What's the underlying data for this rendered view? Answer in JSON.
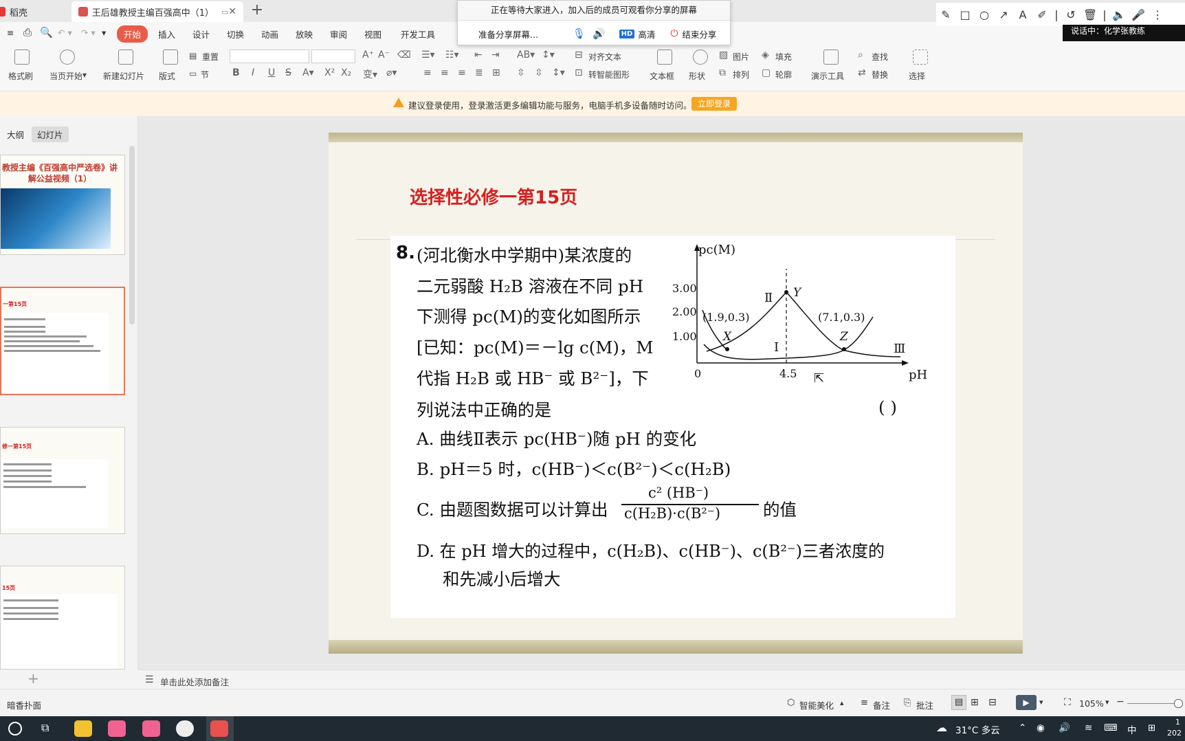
{
  "tabs": {
    "tab1_label": "稻壳",
    "tab2_label": "王后雄教授主编百强高中（1）"
  },
  "share_popup": {
    "message": "正在等待大家进入，加入后的成员可观看你分享的屏幕",
    "preparing": "准备分享屏幕...",
    "hd_badge": "HD",
    "hd_label": "高清",
    "end_share": "结束分享"
  },
  "annotation_tools": [
    "pen-icon",
    "rectangle-icon",
    "circle-icon",
    "arrow-icon",
    "text-icon",
    "highlighter-icon",
    "undo-icon",
    "trash-icon",
    "speaker-icon",
    "mic-icon",
    "more-icon"
  ],
  "speech_label": "说话中：化学张教练",
  "menu": {
    "items": [
      "开始",
      "插入",
      "设计",
      "切换",
      "动画",
      "放映",
      "审阅",
      "视图",
      "开发工具"
    ]
  },
  "ribbon": {
    "format_painter": "格式刷",
    "play_from_current": "当页开始",
    "new_slide": "新建幻灯片",
    "layout": "版式",
    "section": "节",
    "reset": "重置",
    "align_text": "对齐文本",
    "smart_shape": "转智能图形",
    "textbox": "文本框",
    "shape": "形状",
    "picture": "图片",
    "fill": "填充",
    "arrange": "排列",
    "outline": "轮廓",
    "present_tools": "演示工具",
    "find": "查找",
    "replace": "替换",
    "select": "选择"
  },
  "notice": {
    "text": "建议登录使用，登录激活更多编辑功能与服务，电脑手机多设备随时访问。",
    "button": "立即登录"
  },
  "left_pane": {
    "tab_outline": "大纲",
    "tab_slides": "幻灯片",
    "thumb1_title": "教授主编《百强高中严选卷》讲解公益视频（1）",
    "thumb2_title": "一第15页",
    "thumb3_title": "修一第15页",
    "thumb4_title": "15页"
  },
  "slide": {
    "title": "选择性必修一第15页",
    "q_number": "8.",
    "lines": [
      "(河北衡水中学期中)某浓度的",
      "二元弱酸 H₂B 溶液在不同 pH",
      "下测得 pc(M)的变化如图所示",
      "[已知：pc(M)＝－lg c(M)，M",
      "代指 H₂B 或 HB⁻ 或 B²⁻]，下",
      "列说法中正确的是"
    ],
    "answer_paren": "(        )",
    "option_a": "A. 曲线Ⅱ表示 pc(HB⁻)随 pH 的变化",
    "option_b": "B. pH＝5 时，c(HB⁻)＜c(B²⁻)＜c(H₂B)",
    "option_c_prefix": "C. 由题图数据可以计算出",
    "option_c_num": "c² (HB⁻)",
    "option_c_den": "c(H₂B)·c(B²⁻)",
    "option_c_suffix": "的值",
    "option_d_1": "D. 在 pH 增大的过程中，c(H₂B)、c(HB⁻)、c(B²⁻)三者浓度的",
    "option_d_2": "和先减小后增大",
    "graph": {
      "y_axis_label": "pc(M)",
      "x_axis_label": "pH",
      "origin": "0",
      "y_ticks": [
        "3.00",
        "2.00",
        "1.00"
      ],
      "x_tick": "4.5",
      "point_x_label": "X",
      "point_y_label": "Y",
      "point_z_label": "Z",
      "coord_x": "(1.9,0.3)",
      "coord_z": "(7.1,0.3)",
      "curve_1": "Ⅰ",
      "curve_2": "Ⅱ",
      "curve_3": "Ⅲ"
    }
  },
  "notes": {
    "placeholder": "单击此处添加备注"
  },
  "status": {
    "left": "暗香扑面",
    "smart_beautify": "智能美化",
    "notes_btn": "备注",
    "comment_btn": "批注",
    "zoom": "105%"
  },
  "taskbar": {
    "weather": "31°C 多云",
    "ime": "中",
    "time_partial": "1",
    "date_partial": "202"
  }
}
